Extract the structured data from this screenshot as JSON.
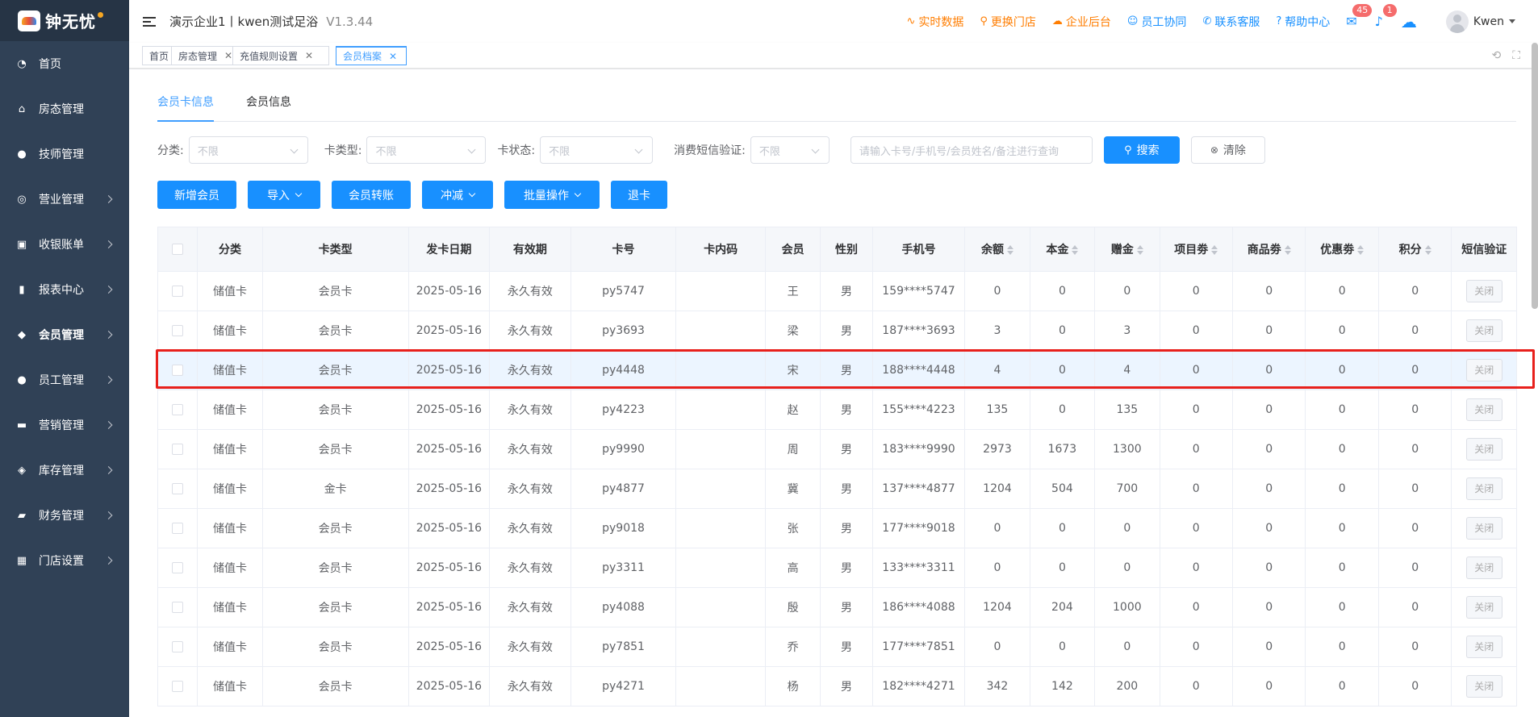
{
  "app": {
    "logo_text": "钟无忧",
    "company": "演示企业1丨kwen测试足浴",
    "version": "V1.3.44"
  },
  "header": {
    "links": [
      {
        "label": "实时数据",
        "icon": "chart-line-icon",
        "color": "#ff7d00"
      },
      {
        "label": "更换门店",
        "icon": "search-icon",
        "color": "#ff7d00"
      },
      {
        "label": "企业后台",
        "icon": "cloud-icon",
        "color": "#ff7d00"
      },
      {
        "label": "员工协同",
        "icon": "users-icon",
        "color": "#1890ff"
      },
      {
        "label": "联系客服",
        "icon": "phone-icon",
        "color": "#1890ff"
      },
      {
        "label": "帮助中心",
        "icon": "help-icon",
        "color": "#1890ff"
      }
    ],
    "mail_badge": "45",
    "bell_badge": "1",
    "username": "Kwen"
  },
  "sidebar": {
    "items": [
      {
        "label": "首页",
        "icon": "dashboard-icon",
        "arrow": false
      },
      {
        "label": "房态管理",
        "icon": "home-icon",
        "arrow": false
      },
      {
        "label": "技师管理",
        "icon": "user-icon",
        "arrow": false
      },
      {
        "label": "营业管理",
        "icon": "target-icon",
        "arrow": true
      },
      {
        "label": "收银账单",
        "icon": "bag-icon",
        "arrow": true
      },
      {
        "label": "报表中心",
        "icon": "bar-chart-icon",
        "arrow": true
      },
      {
        "label": "会员管理",
        "icon": "diamond-icon",
        "arrow": true
      },
      {
        "label": "员工管理",
        "icon": "user-icon",
        "arrow": true
      },
      {
        "label": "营销管理",
        "icon": "briefcase-icon",
        "arrow": true
      },
      {
        "label": "库存管理",
        "icon": "box-icon",
        "arrow": true
      },
      {
        "label": "财务管理",
        "icon": "wallet-icon",
        "arrow": true
      },
      {
        "label": "门店设置",
        "icon": "grid-icon",
        "arrow": true
      }
    ]
  },
  "tags": [
    {
      "label": "首页",
      "closable": false
    },
    {
      "label": "房态管理",
      "closable": true
    },
    {
      "label": "充值规则设置",
      "closable": true
    },
    {
      "label": "会员档案",
      "closable": true,
      "active": true
    }
  ],
  "tabs": [
    "会员卡信息",
    "会员信息"
  ],
  "filters": {
    "category_label": "分类:",
    "category_value": "不限",
    "card_type_label": "卡类型:",
    "card_type_value": "不限",
    "card_status_label": "卡状态:",
    "card_status_value": "不限",
    "sms_label": "消费短信验证:",
    "sms_value": "不限",
    "search_placeholder": "请输入卡号/手机号/会员姓名/备注进行查询",
    "search_button": "搜索",
    "clear_button": "清除"
  },
  "actions": [
    {
      "label": "新增会员",
      "dropdown": false
    },
    {
      "label": "导入",
      "dropdown": true
    },
    {
      "label": "会员转账",
      "dropdown": false
    },
    {
      "label": "冲减",
      "dropdown": true
    },
    {
      "label": "批量操作",
      "dropdown": true
    },
    {
      "label": "退卡",
      "dropdown": false
    }
  ],
  "table": {
    "columns": [
      "",
      "分类",
      "卡类型",
      "发卡日期",
      "有效期",
      "卡号",
      "卡内码",
      "会员",
      "性别",
      "手机号",
      "余额",
      "本金",
      "赠金",
      "项目劵",
      "商品劵",
      "优惠劵",
      "积分",
      "短信验证"
    ],
    "sortable": [
      false,
      false,
      false,
      false,
      false,
      false,
      false,
      false,
      false,
      false,
      true,
      true,
      true,
      true,
      true,
      true,
      true,
      false
    ],
    "sms_button": "关闭",
    "rows": [
      [
        "储值卡",
        "会员卡",
        "2025-05-16",
        "永久有效",
        "py5747",
        "",
        "王",
        "男",
        "159****5747",
        "0",
        "0",
        "0",
        "0",
        "0",
        "0",
        "0"
      ],
      [
        "储值卡",
        "会员卡",
        "2025-05-16",
        "永久有效",
        "py3693",
        "",
        "梁",
        "男",
        "187****3693",
        "3",
        "0",
        "3",
        "0",
        "0",
        "0",
        "0"
      ],
      [
        "储值卡",
        "会员卡",
        "2025-05-16",
        "永久有效",
        "py4448",
        "",
        "宋",
        "男",
        "188****4448",
        "4",
        "0",
        "4",
        "0",
        "0",
        "0",
        "0"
      ],
      [
        "储值卡",
        "会员卡",
        "2025-05-16",
        "永久有效",
        "py4223",
        "",
        "赵",
        "男",
        "155****4223",
        "135",
        "0",
        "135",
        "0",
        "0",
        "0",
        "0"
      ],
      [
        "储值卡",
        "会员卡",
        "2025-05-16",
        "永久有效",
        "py9990",
        "",
        "周",
        "男",
        "183****9990",
        "2973",
        "1673",
        "1300",
        "0",
        "0",
        "0",
        "0"
      ],
      [
        "储值卡",
        "金卡",
        "2025-05-16",
        "永久有效",
        "py4877",
        "",
        "冀",
        "男",
        "137****4877",
        "1204",
        "504",
        "700",
        "0",
        "0",
        "0",
        "0"
      ],
      [
        "储值卡",
        "会员卡",
        "2025-05-16",
        "永久有效",
        "py9018",
        "",
        "张",
        "男",
        "177****9018",
        "0",
        "0",
        "0",
        "0",
        "0",
        "0",
        "0"
      ],
      [
        "储值卡",
        "会员卡",
        "2025-05-16",
        "永久有效",
        "py3311",
        "",
        "高",
        "男",
        "133****3311",
        "0",
        "0",
        "0",
        "0",
        "0",
        "0",
        "0"
      ],
      [
        "储值卡",
        "会员卡",
        "2025-05-16",
        "永久有效",
        "py4088",
        "",
        "殷",
        "男",
        "186****4088",
        "1204",
        "204",
        "1000",
        "0",
        "0",
        "0",
        "0"
      ],
      [
        "储值卡",
        "会员卡",
        "2025-05-16",
        "永久有效",
        "py7851",
        "",
        "乔",
        "男",
        "177****7851",
        "0",
        "0",
        "0",
        "0",
        "0",
        "0",
        "0"
      ],
      [
        "储值卡",
        "会员卡",
        "2025-05-16",
        "永久有效",
        "py4271",
        "",
        "杨",
        "男",
        "182****4271",
        "342",
        "142",
        "200",
        "0",
        "0",
        "0",
        "0"
      ]
    ],
    "highlight_row": 2
  },
  "colors": {
    "sidebar_bg": "#304156",
    "primary": "#1890ff",
    "accent_orange": "#ff7d00",
    "highlight": "#e8201c"
  }
}
